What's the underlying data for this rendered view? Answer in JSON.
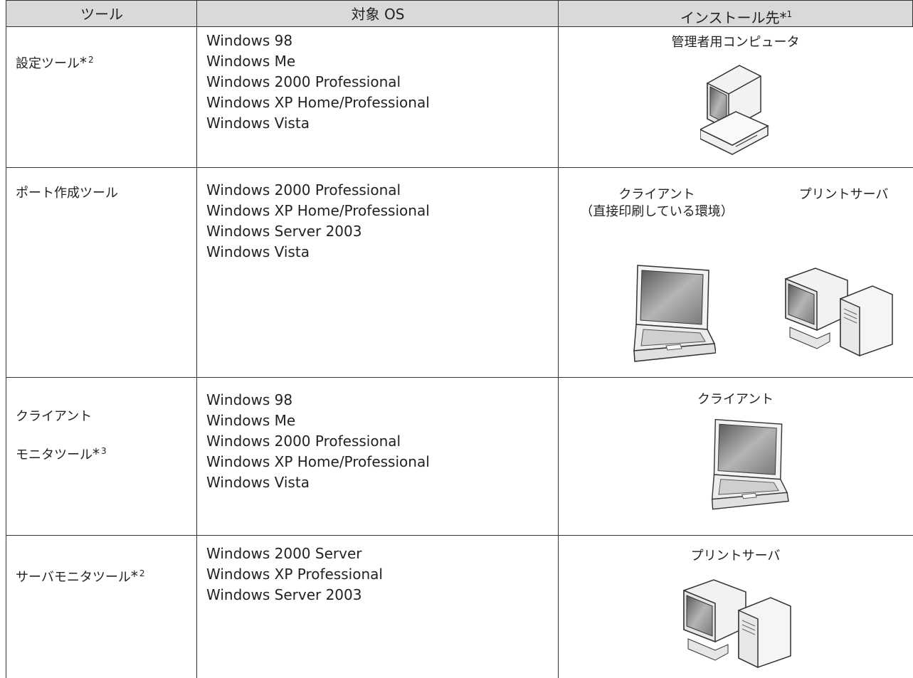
{
  "headers": {
    "tool": "ツール",
    "os": "対象 OS",
    "install": "インストール先",
    "install_note": "1"
  },
  "rows": [
    {
      "tool": "設定ツール",
      "tool_note": "2",
      "os": [
        "Windows 98",
        "Windows Me",
        "Windows 2000 Professional",
        "Windows XP Home/Professional",
        "Windows Vista"
      ],
      "install": [
        "管理者用コンピュータ"
      ]
    },
    {
      "tool": "ポート作成ツール",
      "tool_note": "",
      "os": [
        "Windows 2000 Professional",
        "Windows XP Home/Professional",
        "Windows Server 2003",
        "Windows Vista"
      ],
      "install": [
        "クライアント",
        "（直接印刷している環境）",
        "プリントサーバ"
      ]
    },
    {
      "tool_line1": "クライアント",
      "tool_line2": "モニタツール",
      "tool_note": "3",
      "os": [
        "Windows 98",
        "Windows Me",
        "Windows 2000 Professional",
        "Windows XP Home/Professional",
        "Windows Vista"
      ],
      "install": [
        "クライアント"
      ]
    },
    {
      "tool": "サーバモニタツール",
      "tool_note": "2",
      "os": [
        "Windows 2000 Server",
        "Windows XP Professional",
        "Windows Server 2003"
      ],
      "install": [
        "プリントサーバ"
      ]
    }
  ],
  "icons": {
    "desktop": "desktop-computer-icon",
    "laptop": "laptop-icon",
    "server": "print-server-icon"
  },
  "colors": {
    "header_bg": "#d9d9d9",
    "border": "#333333",
    "screen": "#888888"
  }
}
